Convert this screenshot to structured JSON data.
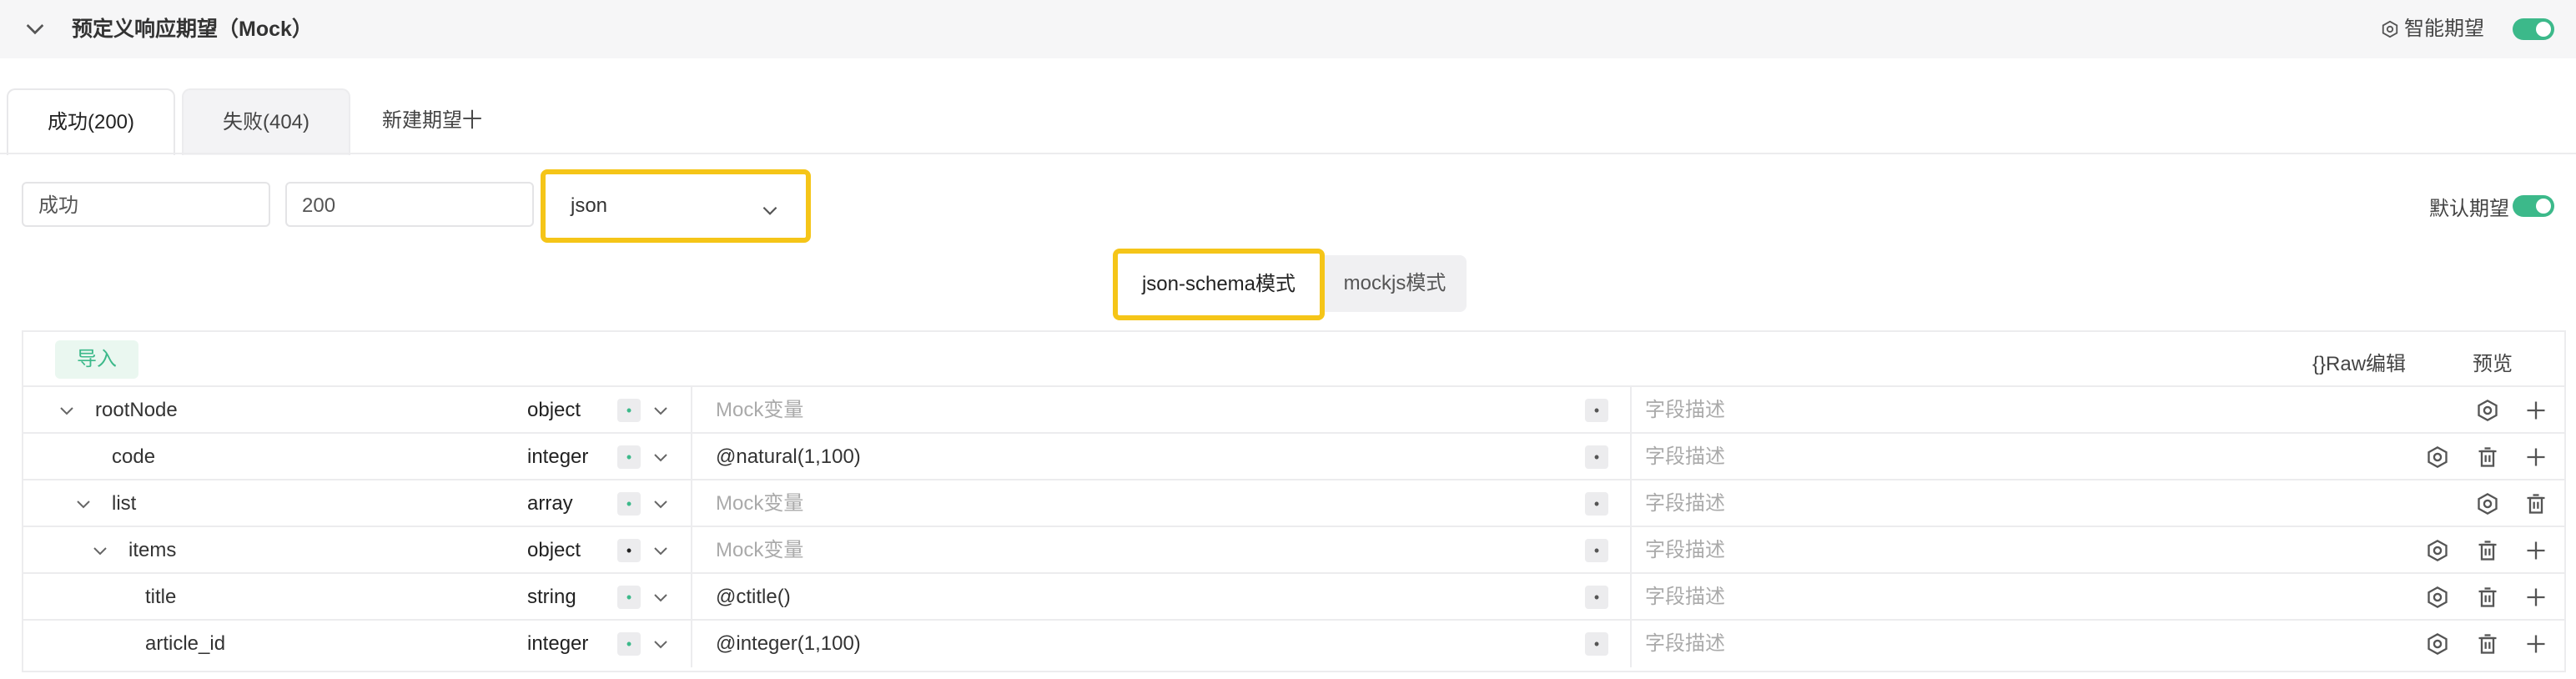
{
  "header": {
    "title": "预定义响应期望（Mock）",
    "smart_label": "智能期望",
    "smart_enabled": true
  },
  "tabs": [
    {
      "label": "成功(200)",
      "active": true
    },
    {
      "label": "失败(404)",
      "active": false
    },
    {
      "label": "新建期望十",
      "active": false
    }
  ],
  "form": {
    "name_value": "成功",
    "code_value": "200",
    "format_value": "json",
    "default_label": "默认期望",
    "default_enabled": true
  },
  "modes": {
    "schema_label": "json-schema模式",
    "mockjs_label": "mockjs模式",
    "active": "json-schema模式"
  },
  "table": {
    "import_label": "导入",
    "raw_label": "{}Raw编辑",
    "preview_label": "预览",
    "desc_placeholder": "字段描述",
    "rows": [
      {
        "name": "rootNode",
        "type": "object",
        "mock": "Mock变量",
        "mock_is_placeholder": true
      },
      {
        "name": "code",
        "type": "integer",
        "mock": "@natural(1,100)",
        "mock_is_placeholder": false
      },
      {
        "name": "list",
        "type": "array",
        "mock": "Mock变量",
        "mock_is_placeholder": true
      },
      {
        "name": "items",
        "type": "object",
        "mock": "Mock变量",
        "mock_is_placeholder": true
      },
      {
        "name": "title",
        "type": "string",
        "mock": "@ctitle()",
        "mock_is_placeholder": false
      },
      {
        "name": "article_id",
        "type": "integer",
        "mock": "@integer(1,100)",
        "mock_is_placeholder": false
      }
    ],
    "required_marker": "•"
  },
  "colors": {
    "accent": "#3cb98a",
    "highlight": "#f5c518"
  }
}
